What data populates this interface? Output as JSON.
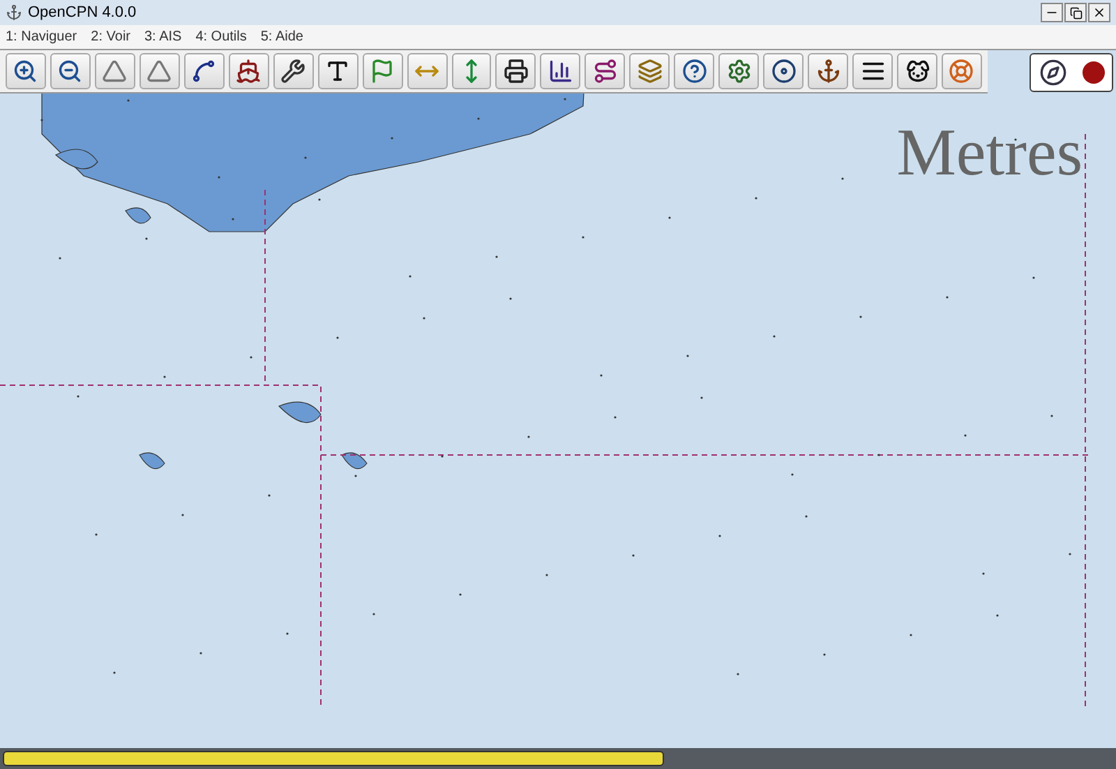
{
  "window": {
    "title": "OpenCPN 4.0.0"
  },
  "menu": [
    {
      "label": "1: Naviguer"
    },
    {
      "label": "2: Voir"
    },
    {
      "label": "3: AIS"
    },
    {
      "label": "4: Outils"
    },
    {
      "label": "5: Aide"
    }
  ],
  "map": {
    "units_label": "Metres"
  }
}
